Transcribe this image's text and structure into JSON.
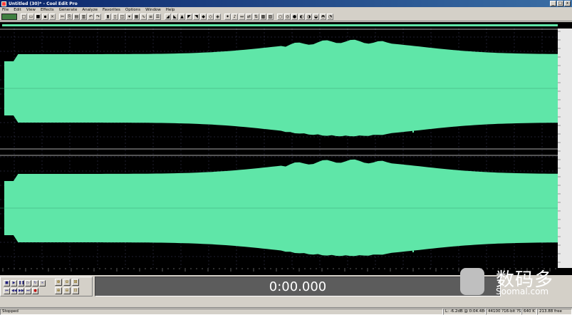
{
  "window": {
    "title": "Untitled (30)* - Cool Edit Pro",
    "controls": [
      "_",
      "□",
      "x"
    ]
  },
  "menu": [
    "File",
    "Edit",
    "View",
    "Effects",
    "Generate",
    "Analyze",
    "Favorites",
    "Options",
    "Window",
    "Help"
  ],
  "colors": {
    "waveform": "#5fe6a8",
    "background": "#000000",
    "grid": "#404060"
  },
  "waveform": {
    "channels": [
      {
        "id": "left",
        "zero_line": "0"
      },
      {
        "id": "right",
        "zero_line": "0"
      }
    ]
  },
  "transport": {
    "buttons": [
      "stop",
      "play",
      "pause",
      "play-from-cursor",
      "play-looped",
      "go-to-beginning",
      "rewind",
      "fast-forward",
      "go-to-end",
      "record"
    ],
    "zoom_buttons": [
      "zoom-in-horizontal",
      "zoom-out-horizontal",
      "zoom-full",
      "zoom-in-vertical",
      "zoom-out-vertical",
      "zoom-selection"
    ]
  },
  "time_display": "0:00.000",
  "watermark": {
    "cn": "数码多",
    "en": "Soomal.com"
  },
  "status": {
    "state": "Stopped",
    "level": "L: -6.2dB @ 0:04.484",
    "format": "44100 ?16-bit ?Stereo",
    "size": "640 K",
    "free": "213.88 free"
  }
}
